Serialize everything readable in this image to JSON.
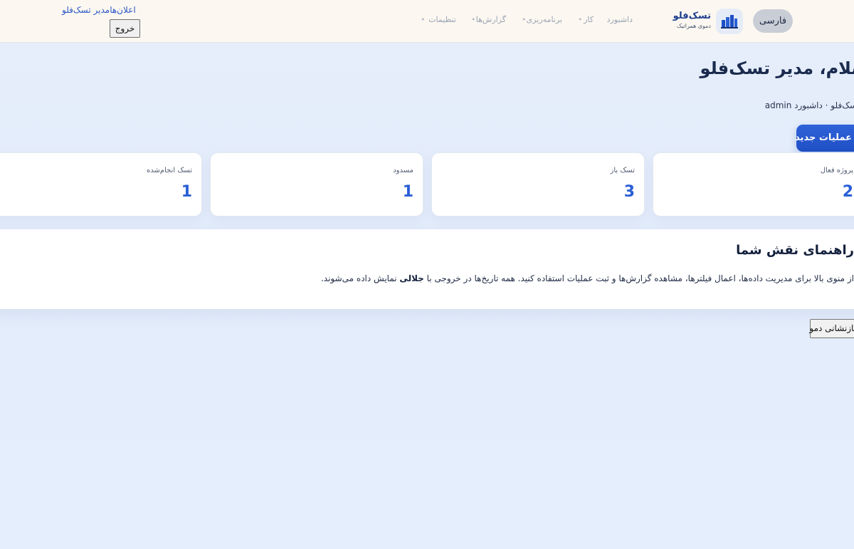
{
  "header": {
    "language_button": "فارسی",
    "brand_title": "تسک‌فلو",
    "brand_subtitle": "دموی همراتیک",
    "logo_icon": "building-bars-icon",
    "nav": [
      {
        "label": "داشبورد"
      },
      {
        "label": "کار"
      },
      {
        "label": "برنامه‌ریزی"
      },
      {
        "label": "گزارش‌ها"
      },
      {
        "label": "تنظیمات"
      }
    ],
    "notifications_link": "اعلان‌هامدیر تسک‌فلو",
    "logout_button": "خروج"
  },
  "main": {
    "title": "سلام، مدیر تسک‌فلو",
    "breadcrumb": "تسک‌فلو · داشبورد admin",
    "new_operation_button": "عملیات جدید"
  },
  "stats": [
    {
      "label": "پروژه فعال",
      "value": "2"
    },
    {
      "label": "تسک باز",
      "value": "3"
    },
    {
      "label": "مسدود",
      "value": "1"
    },
    {
      "label": "تسک انجام‌شده",
      "value": "1"
    }
  ],
  "guide": {
    "title": "راهنمای نقش شما",
    "text_before": "از منوی بالا برای مدیریت داده‌ها، اعمال فیلترها، مشاهده گزارش‌ها و ثبت عملیات استفاده کنید. همه تاریخ‌ها در خروجی با ",
    "text_bold": "جلالی",
    "text_after": " نمایش داده می‌شوند."
  },
  "reset_demo_button": "بازنشانی دمو",
  "colors": {
    "accent": "#2a5fd6",
    "header_bg": "#fcf8f1",
    "page_bg": "#e4edfb"
  }
}
